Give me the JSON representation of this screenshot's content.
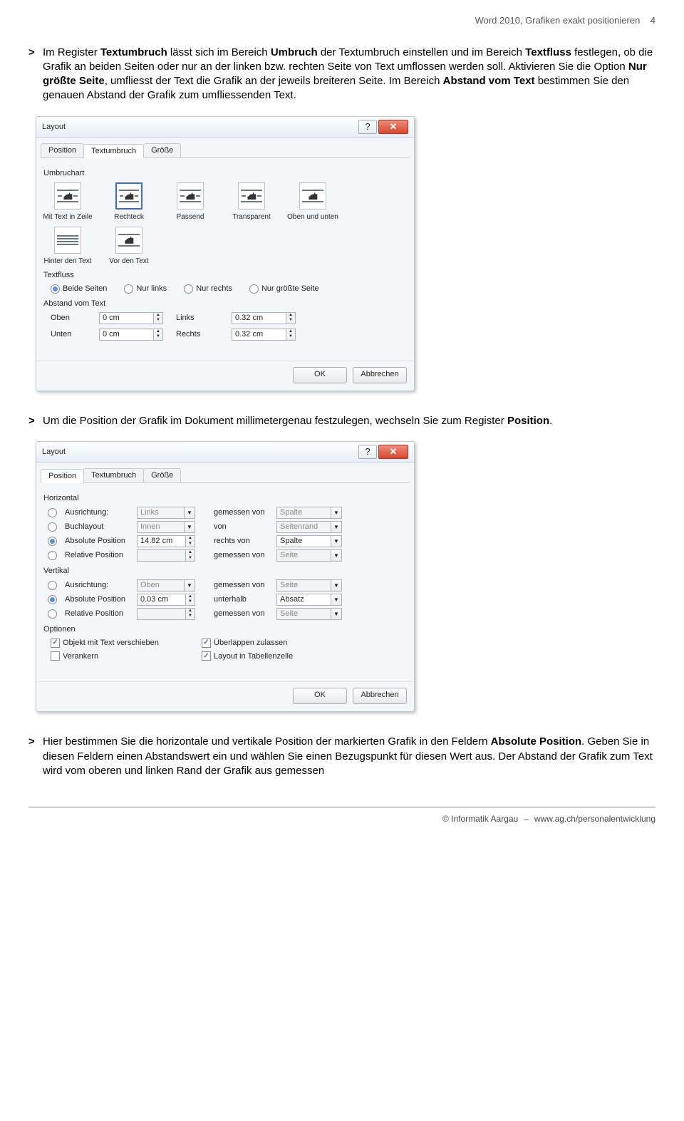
{
  "header": {
    "title": "Word 2010, Grafiken exakt positionieren",
    "page": "4"
  },
  "paragraphs": {
    "p1": "Im Register Textumbruch lässt sich im Bereich Umbruch der Textumbruch einstellen und im Bereich Textfluss festlegen, ob die Grafik an beiden Seiten oder nur an der linken bzw. rechten Seite von Text umflossen werden soll. Aktivieren Sie die Option Nur größte Seite, umfliesst der Text die Grafik an der jeweils breiteren Seite. Im Bereich Abstand vom Text bestimmen Sie den genauen Abstand der Grafik zum umfliessenden Text.",
    "p2": "Um die Position der Grafik im Dokument millimetergenau festzulegen, wechseln Sie zum Register Position.",
    "p3": "Hier bestimmen Sie die horizontale und vertikale Position der markierten Grafik in den Feldern Absolute Position. Geben Sie in diesen Feldern einen Abstandswert ein und wählen Sie einen Bezugspunkt für diesen Wert aus. Der Abstand der Grafik zum Text wird vom oberen und linken Rand der Grafik aus gemessen"
  },
  "dlg": {
    "title": "Layout",
    "help": "?",
    "tabs": {
      "position": "Position",
      "textumbruch": "Textumbruch",
      "groesse": "Größe"
    },
    "d1": {
      "grp_umbruchart": "Umbruchart",
      "wrap": [
        "Mit Text in Zeile",
        "Rechteck",
        "Passend",
        "Transparent",
        "Oben und unten",
        "Hinter den Text",
        "Vor den Text"
      ],
      "grp_textfluss": "Textfluss",
      "tf": [
        "Beide Seiten",
        "Nur links",
        "Nur rechts",
        "Nur größte Seite"
      ],
      "grp_abstand": "Abstand vom Text",
      "abst": {
        "oben": "Oben",
        "unten": "Unten",
        "links": "Links",
        "rechts": "Rechts",
        "v_oben": "0 cm",
        "v_unten": "0 cm",
        "v_links": "0.32 cm",
        "v_rechts": "0.32 cm"
      }
    },
    "d2": {
      "grp_horiz": "Horizontal",
      "lbl": {
        "ausrichtung": "Ausrichtung:",
        "buchlayout": "Buchlayout",
        "abs": "Absolute Position",
        "rel": "Relative Position",
        "gemessen": "gemessen von",
        "von": "von",
        "rechtsvon": "rechts von",
        "unterhalb": "unterhalb"
      },
      "val": {
        "h_align": "Links",
        "h_buch": "Innen",
        "h_abs": "14.82 cm",
        "h_rel": "",
        "h_ref1": "Spalte",
        "h_ref2": "Seitenrand",
        "h_ref3": "Spalte",
        "h_ref4": "Seite",
        "v_align": "Oben",
        "v_abs": "0.03 cm",
        "v_rel": "",
        "v_ref1": "Seite",
        "v_ref2": "Absatz",
        "v_ref3": "Seite"
      },
      "grp_vert": "Vertikal",
      "grp_opt": "Optionen",
      "opt": [
        "Objekt mit Text verschieben",
        "Verankern",
        "Überlappen zulassen",
        "Layout in Tabellenzelle"
      ]
    },
    "btn_ok": "OK",
    "btn_cancel": "Abbrechen"
  },
  "footer": {
    "copy": "© Informatik Aargau",
    "sep": "–",
    "url": "www.ag.ch/personalentwicklung"
  }
}
